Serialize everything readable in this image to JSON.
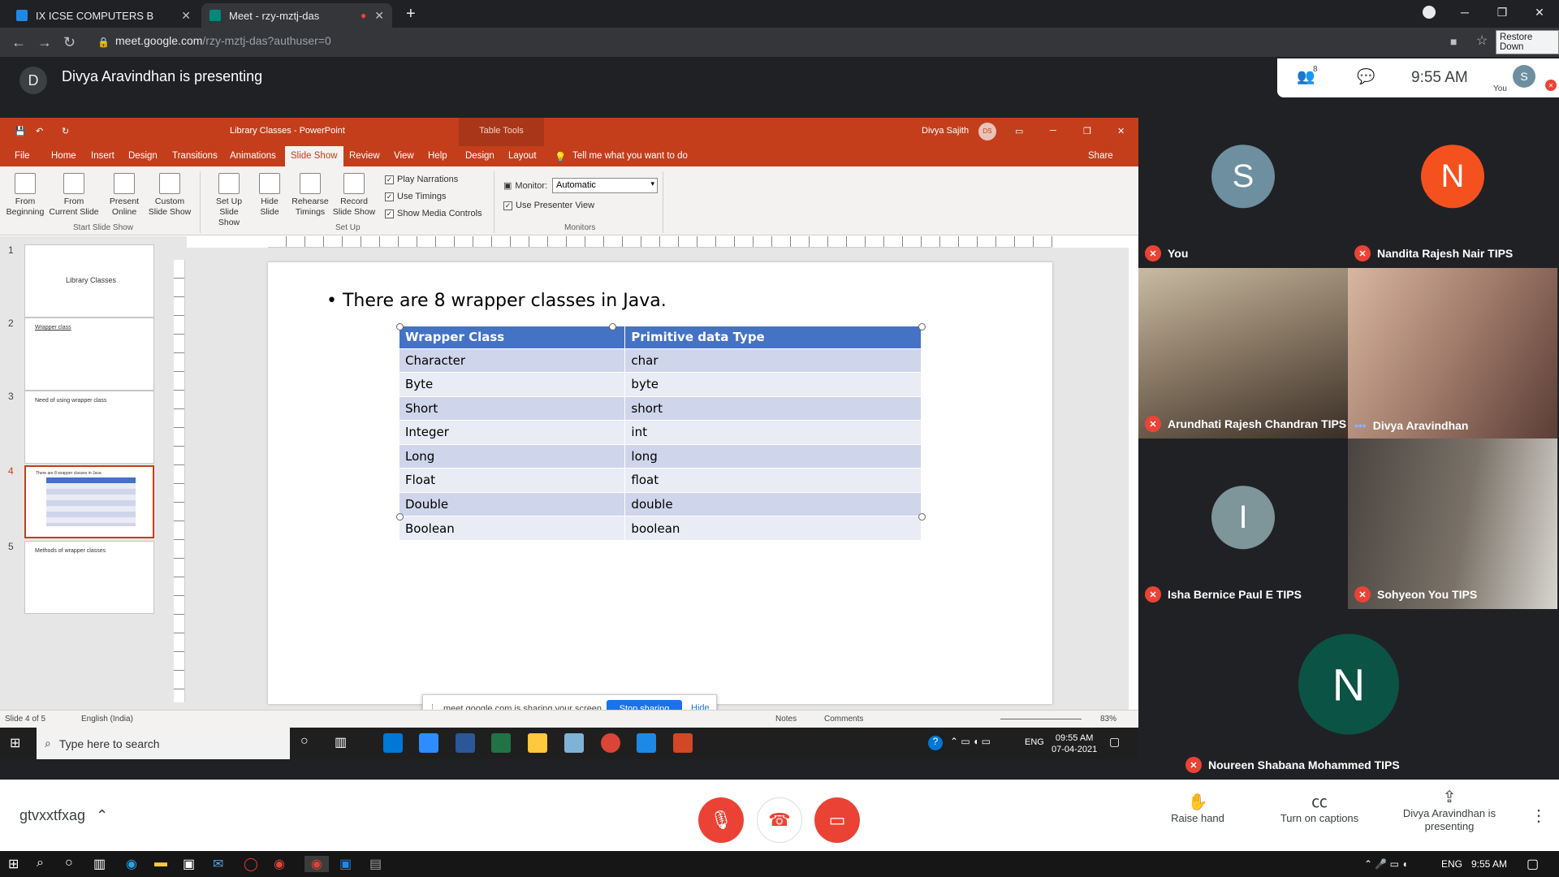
{
  "browser": {
    "tabs": [
      {
        "label": "IX ICSE COMPUTERS B",
        "active": false
      },
      {
        "label": "Meet - rzy-mztj-das",
        "active": true
      }
    ],
    "url_host": "meet.google.com",
    "url_path": "/rzy-mztj-das?authuser=0",
    "tooltip": "Restore Down"
  },
  "meet_header": {
    "presenter_initial": "D",
    "presenting_text": "Divya Aravindhan is presenting",
    "participant_count": "8",
    "time": "9:55 AM",
    "self_initial": "S",
    "self_label": "You"
  },
  "powerpoint": {
    "title": "Library Classes  -  PowerPoint",
    "table_tools": "Table Tools",
    "user": "Divya Sajith",
    "user_initials": "DS",
    "tabs": [
      "File",
      "Home",
      "Insert",
      "Design",
      "Transitions",
      "Animations",
      "Slide Show",
      "Review",
      "View",
      "Help",
      "Design",
      "Layout"
    ],
    "tell_me": "Tell me what you want to do",
    "share": "Share",
    "ribbon": {
      "from_beginning": "From Beginning",
      "from_current": "From Current Slide",
      "present_online": "Present Online",
      "custom_show": "Custom Slide Show",
      "setup_show": "Set Up Slide Show",
      "hide_slide": "Hide Slide",
      "rehearse": "Rehearse Timings",
      "record": "Record Slide Show",
      "play_narrations": "Play Narrations",
      "use_timings": "Use Timings",
      "show_media": "Show Media Controls",
      "monitor_label": "Monitor:",
      "monitor_value": "Automatic",
      "presenter_view": "Use Presenter View",
      "group_start": "Start Slide Show",
      "group_setup": "Set Up",
      "group_monitors": "Monitors"
    },
    "thumbnails": [
      {
        "num": "1",
        "title": "Library Classes"
      },
      {
        "num": "2",
        "title": "Wrapper class"
      },
      {
        "num": "3",
        "title": "Need of using wrapper class"
      },
      {
        "num": "4",
        "title": "There are 8 wrapper classes in Java"
      },
      {
        "num": "5",
        "title": "Methods of wrapper classes"
      }
    ],
    "slide": {
      "bullet": "There are 8 wrapper classes in Java.",
      "headers": [
        "Wrapper Class",
        "Primitive data Type"
      ],
      "rows": [
        [
          "Character",
          "char"
        ],
        [
          "Byte",
          "byte"
        ],
        [
          "Short",
          "short"
        ],
        [
          "Integer",
          "int"
        ],
        [
          "Long",
          "long"
        ],
        [
          "Float",
          "float"
        ],
        [
          "Double",
          "double"
        ],
        [
          "Boolean",
          "boolean"
        ]
      ]
    },
    "share_bar": {
      "text": "meet.google.com is sharing your screen.",
      "stop": "Stop sharing",
      "hide": "Hide"
    },
    "status": {
      "slide_of": "Slide 4 of 5",
      "language": "English (India)",
      "notes": "Notes",
      "comments": "Comments",
      "zoom": "83%"
    },
    "taskbar": {
      "search": "Type here to search",
      "lang": "ENG",
      "time": "09:55 AM",
      "date": "07-04-2021"
    }
  },
  "participants": [
    {
      "name": "You",
      "initial": "S",
      "color": "#6d8fa0",
      "video": false
    },
    {
      "name": "Nandita Rajesh Nair TIPS",
      "initial": "N",
      "color": "#f4511e",
      "video": false
    },
    {
      "name": "Arundhati Rajesh Chandran TIPS",
      "initial": "",
      "color": "#8a7a66",
      "video": true
    },
    {
      "name": "Divya Aravindhan",
      "initial": "",
      "color": "#a07a6a",
      "video": true
    },
    {
      "name": "Isha Bernice Paul E TIPS",
      "initial": "I",
      "color": "#7e959a",
      "video": false
    },
    {
      "name": "Sohyeon You TIPS",
      "initial": "",
      "color": "#7a7268",
      "video": true
    },
    {
      "name": "Noureen Shabana Mohammed TIPS",
      "initial": "N",
      "color": "#0b5345",
      "video": false
    }
  ],
  "meet_footer": {
    "meeting_code": "gtvxxtfxag",
    "raise_hand": "Raise hand",
    "captions": "Turn on captions",
    "presenting": "Divya Aravindhan is presenting"
  },
  "host_taskbar": {
    "lang": "ENG",
    "time": "9:55 AM"
  }
}
